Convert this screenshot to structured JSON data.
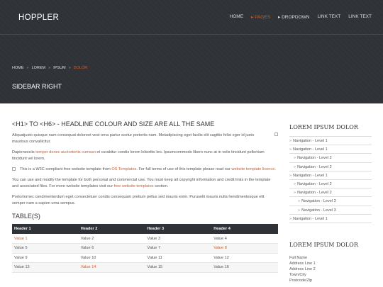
{
  "header": {
    "logo": "HOPPLER",
    "nav": [
      {
        "label": "HOME",
        "active": false,
        "arrow": false
      },
      {
        "label": "PAGES",
        "active": true,
        "arrow": true
      },
      {
        "label": "DROPDOWN",
        "active": false,
        "arrow": true
      },
      {
        "label": "LINK TEXT",
        "active": false,
        "arrow": false
      },
      {
        "label": "LINK TEXT",
        "active": false,
        "arrow": false
      }
    ],
    "breadcrumbs": [
      "HOME",
      "LOREM",
      "IPSUM",
      "DOLOR"
    ],
    "breadcrumb_sep": "»",
    "page_title": "SIDEBAR RIGHT"
  },
  "content": {
    "heading": "<H1> TO <H6> - HEADLINE COLOUR AND SIZE ARE ALL THE SAME",
    "p1": "Aliquatjusto quisque nam consequat doloreet vest orna partur scetur portortis nam. Metadipiscing eget facilis elit sagittis felisi eger id justo maurisus convallicitur.",
    "p2_pre": "Dapiensociis ",
    "p2_link": "temper donec auctortortis cumsan",
    "p2_post": " et curabitur condis lorem loborttis leo. Ipsumcommodo libero nunc at in velis tincidunt pellentum tincidunt vel lorem.",
    "p3_pre": "This is a W3C compliant free website template from ",
    "p3_link1": "OS Templates",
    "p3_mid": ". For full terms of use of this template please read our ",
    "p3_link2": "website template licence",
    "p3_post": ".",
    "p4_pre": "You can use and modify the template for both personal and commercial use. You must keep all copyright information and credit links in the template and associated files. For more website templates visit our ",
    "p4_link": "free website templates",
    "p4_post": " section.",
    "p5": "Portortornec condimenterdum eget consectetuer condis consequam pretium pellus sed mauris enim. Puruselit mauris nulla hendimentesque elit semper nam a sapien urna sempus.",
    "tables_heading": "TABLE(S)",
    "table": {
      "headers": [
        "Header 1",
        "Header 2",
        "Header 3",
        "Header 4"
      ],
      "rows": [
        [
          "Value 1",
          "Value 2",
          "Value 3",
          "Value 4"
        ],
        [
          "Value 5",
          "Value 6",
          "Value 7",
          "Value 8"
        ],
        [
          "Value 9",
          "Value 10",
          "Value 11",
          "Value 12"
        ],
        [
          "Value 13",
          "Value 14",
          "Value 15",
          "Value 16"
        ]
      ]
    }
  },
  "sidebar": {
    "heading": "LOREM IPSUM DOLOR",
    "nav": [
      {
        "label": "Navigation - Level 1",
        "level": 1
      },
      {
        "label": "Navigation - Level 1",
        "level": 1
      },
      {
        "label": "Navigation - Level 2",
        "level": 2
      },
      {
        "label": "Navigation - Level 2",
        "level": 2
      },
      {
        "label": "Navigation - Level 1",
        "level": 1
      },
      {
        "label": "Navigation - Level 2",
        "level": 2
      },
      {
        "label": "Navigation - Level 2",
        "level": 2
      },
      {
        "label": "Navigation - Level 3",
        "level": 3
      },
      {
        "label": "Navigation - Level 3",
        "level": 3
      },
      {
        "label": "Navigation - Level 1",
        "level": 1
      }
    ],
    "heading2": "LOREM IPSUM DOLOR",
    "address": [
      "Full Name",
      "Address Line 1",
      "Address Line 2",
      "Town/City",
      "Postcode/Zip"
    ]
  }
}
